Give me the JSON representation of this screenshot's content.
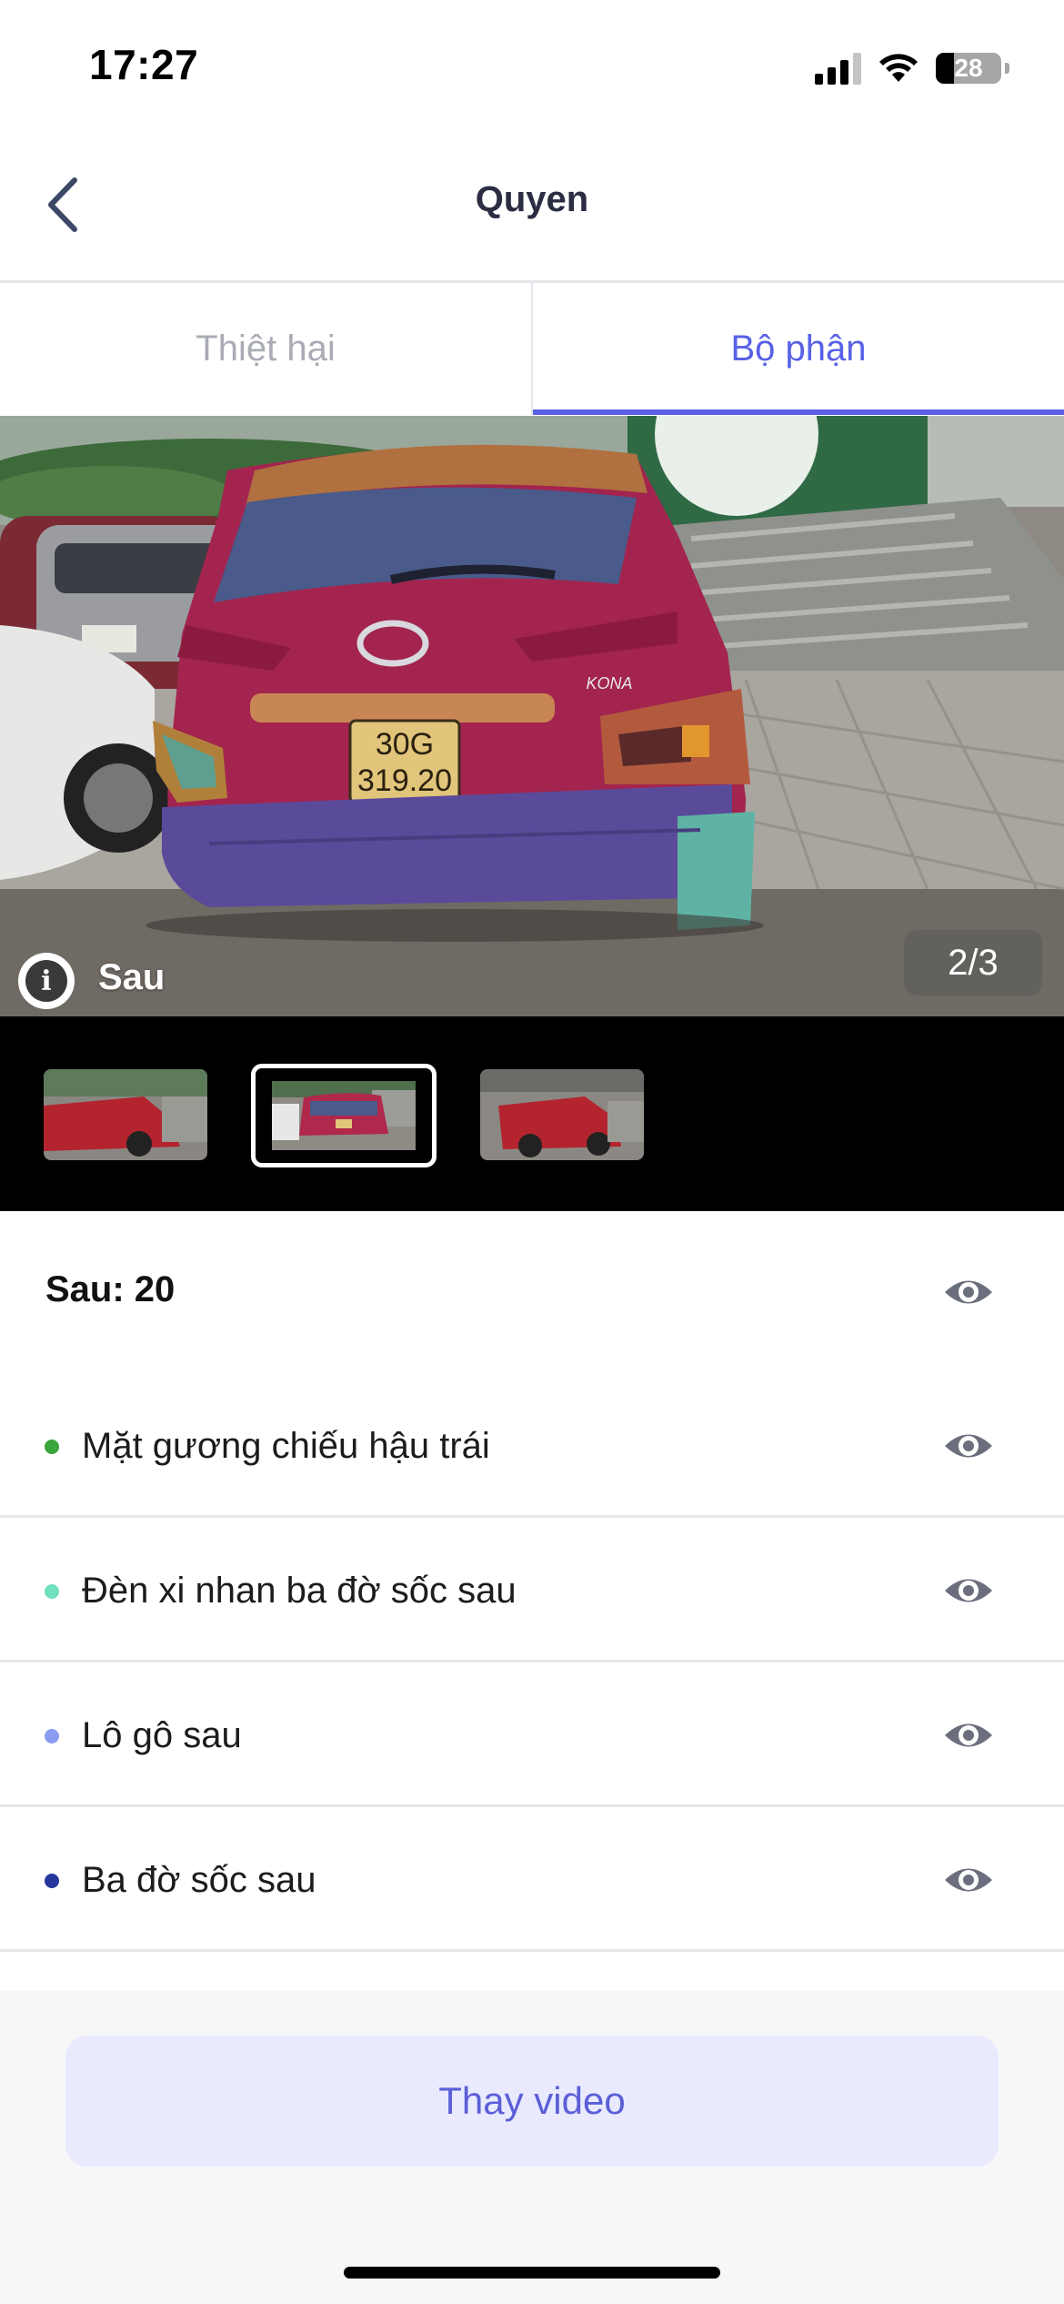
{
  "status_bar": {
    "time": "17:27",
    "battery": "28",
    "signal_bars_active": 3,
    "icons": [
      "cellular-signal-icon",
      "wifi-icon",
      "battery-icon"
    ]
  },
  "nav": {
    "title": "Quyen",
    "back_icon": "chevron-left-icon"
  },
  "tabs": [
    {
      "label": "Thiệt hại",
      "active": false
    },
    {
      "label": "Bộ phận",
      "active": true
    }
  ],
  "viewer": {
    "view_label": "Sau",
    "counter": "2/3",
    "info_icon": "info-icon",
    "plate_line1": "30G",
    "plate_line2": "319.20",
    "badge_text": "KONA",
    "thumbnail_count": 3,
    "selected_thumbnail": 2
  },
  "summary": {
    "text": "Sau: 20"
  },
  "parts": [
    {
      "label": "Mặt gương chiếu hậu trái",
      "color": "#3aa53a"
    },
    {
      "label": "Đèn xi nhan ba đờ sốc sau",
      "color": "#6fe0c0"
    },
    {
      "label": "Lô gô sau",
      "color": "#8b9cf0"
    },
    {
      "label": "Ba đờ sốc sau",
      "color": "#26379e"
    }
  ],
  "actions": {
    "replace_video": "Thay video"
  },
  "colors": {
    "accent": "#5b5fe6",
    "cta_background": "#e9eafd",
    "eye_icon": "#6b6f7d"
  }
}
